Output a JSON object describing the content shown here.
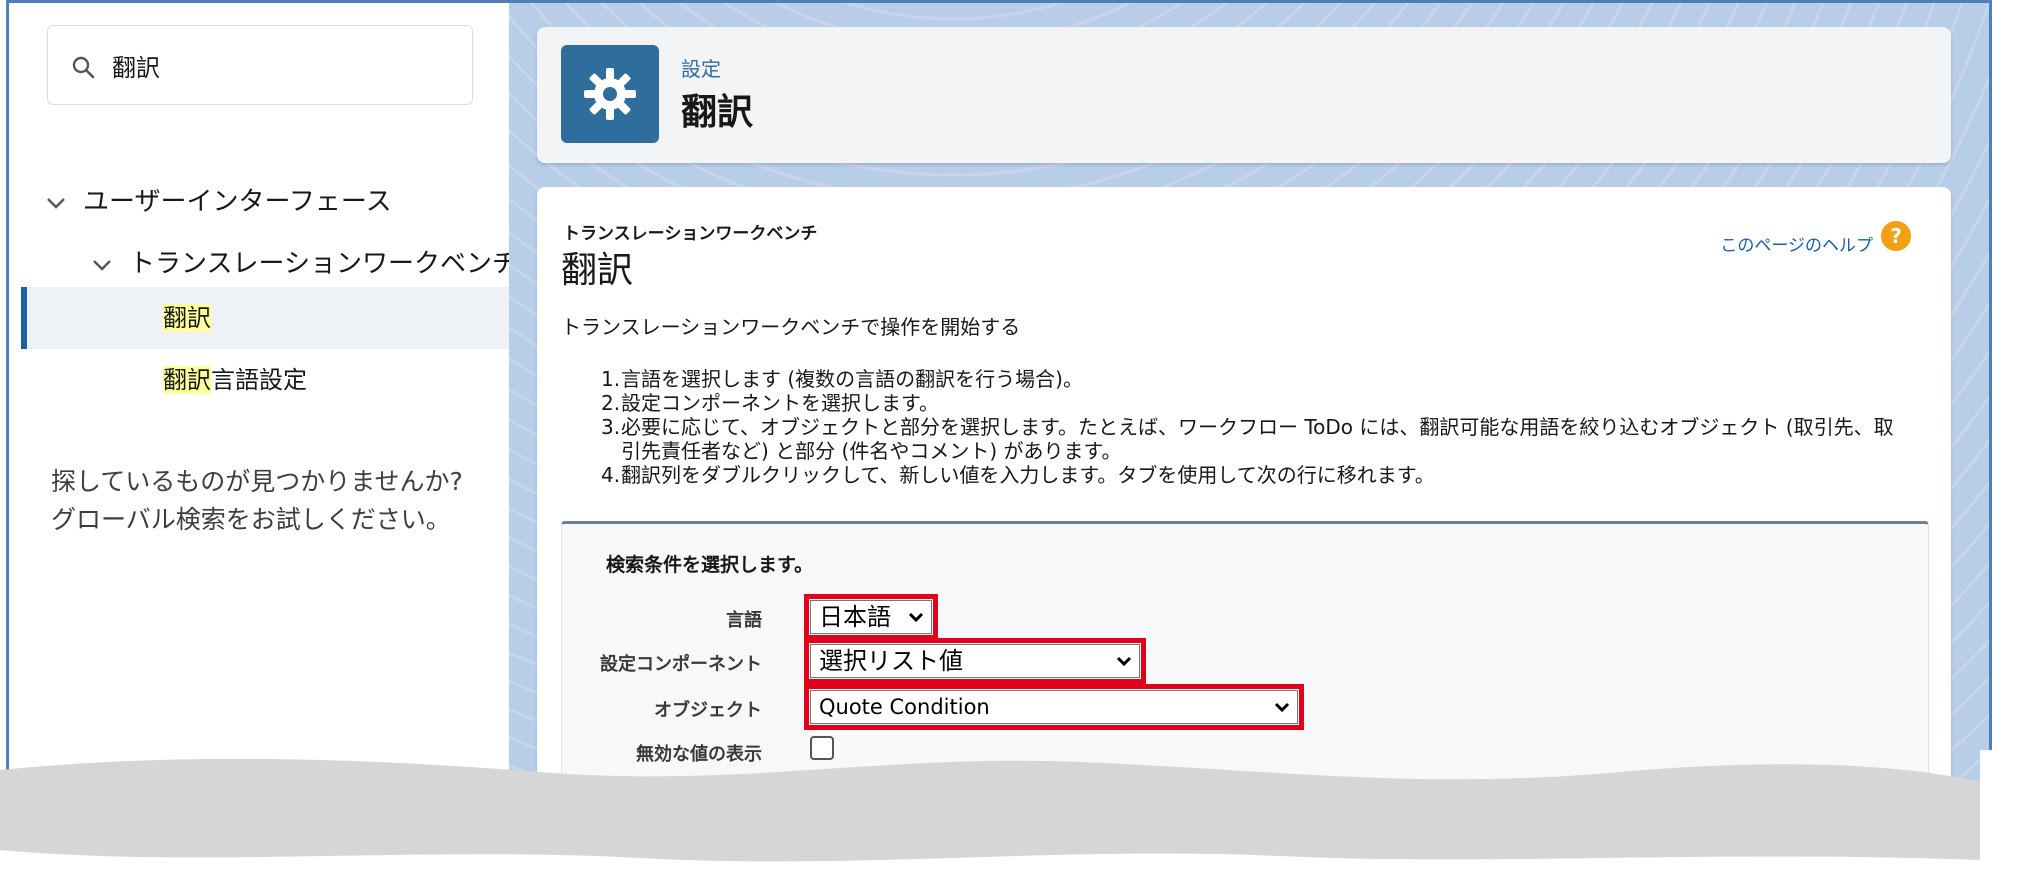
{
  "sidebar": {
    "search": {
      "value": "翻訳"
    },
    "tree": {
      "level1": "ユーザーインターフェース",
      "level2": "トランスレーションワークベンチ",
      "items": [
        {
          "highlight": "翻訳",
          "rest": ""
        },
        {
          "highlight": "翻訳",
          "rest": "言語設定"
        }
      ]
    },
    "not_found": {
      "line1": "探しているものが見つかりませんか?",
      "line2": "グローバル検索をお試しください。"
    }
  },
  "header": {
    "subtitle": "設定",
    "title": "翻訳",
    "icon": "gear-icon"
  },
  "content": {
    "breadcrumb": "トランスレーションワークベンチ",
    "heading": "翻訳",
    "help_link": "このページのヘルプ",
    "help_icon": "?",
    "intro": "トランスレーションワークベンチで操作を開始する",
    "steps": [
      {
        "num": "1.",
        "text": "言語を選択します (複数の言語の翻訳を行う場合)。"
      },
      {
        "num": "2.",
        "text": "設定コンポーネントを選択します。"
      },
      {
        "num": "3.",
        "text": "必要に応じて、オブジェクトと部分を選択します。たとえば、ワークフロー ToDo には、翻訳可能な用語を絞り込むオブジェクト (取引先、取",
        "cont": "引先責任者など) と部分 (件名やコメント) があります。"
      },
      {
        "num": "4.",
        "text": "翻訳列をダブルクリックして、新しい値を入力します。タブを使用して次の行に移れます。"
      }
    ]
  },
  "criteria": {
    "title": "検索条件を選択します。",
    "language": {
      "label": "言語",
      "value": "日本語"
    },
    "component": {
      "label": "設定コンポーネント",
      "value": "選択リスト値"
    },
    "object": {
      "label": "オブジェクト",
      "value": "Quote Condition"
    },
    "show_invalid": {
      "label": "無効な値の表示",
      "checked": false
    }
  },
  "colors": {
    "highlight_box": "#e0001b",
    "brand": "#2f6e9c",
    "selected_bar": "#1b5fa6"
  }
}
